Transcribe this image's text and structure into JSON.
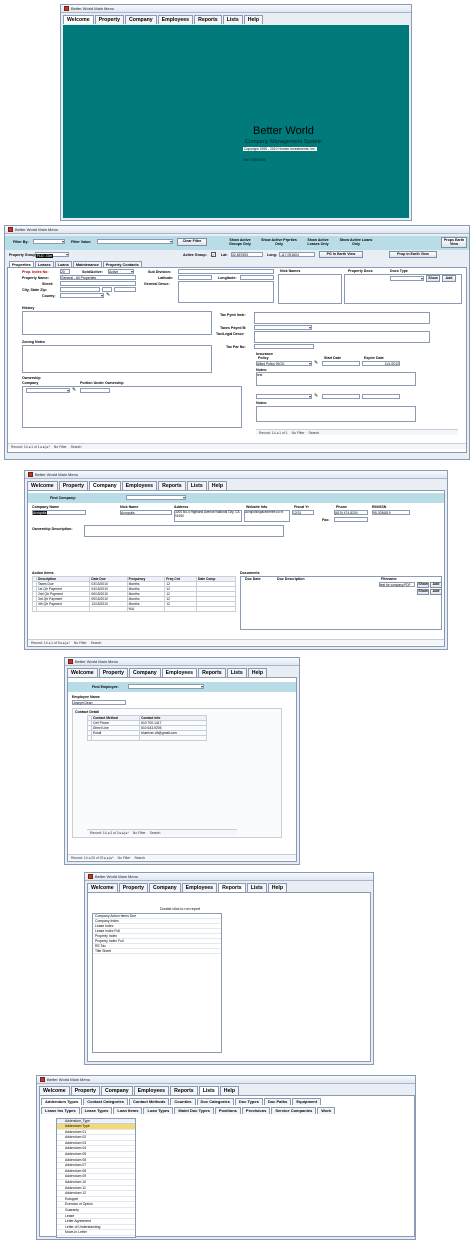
{
  "app_title": "Better World Main Menu",
  "main_tabs": [
    "Welcome",
    "Property",
    "Company",
    "Employees",
    "Reports",
    "Lists",
    "Help"
  ],
  "welcome": {
    "title": "Better World",
    "subtitle": "Company Management System",
    "copyright": "Copyright 1995 - 2010 Homec Investments, Inc.",
    "version": "Ver 2/19/2009",
    "bg_color": "#007a7a"
  },
  "property": {
    "filter_by_label": "Filter By:",
    "filter_value_label": "Filter Value:",
    "clear_filter": "Clear Filter",
    "show_active_groups": "Show Active Groups Only",
    "show_active_properties": "Show Active Prprties Only",
    "show_active_leases": "Show Active Leases Only",
    "show_active_loans": "Show Active Loans Only",
    "props_earth_view": "Props Earth View",
    "property_group_label": "Property Group:",
    "property_group_value": "FLD - Gnr",
    "active_group_label": "Active Group:",
    "lat_label": "Lat:",
    "lat_value": "32.657693",
    "long_label": "Long:",
    "long_value": "-117.091604",
    "pg_earth_view": "PG In Earth View",
    "prop_earth_view": "Prop In Earth View",
    "sub_tabs": [
      "Properties",
      "Leases",
      "Loans",
      "Maintenance",
      "Property Contacts"
    ],
    "prop_index_label": "Prop. Index No:",
    "prop_index_value": "20",
    "sold_active_label": "Sold/Active:",
    "sold_active_value": "Active",
    "property_name_label": "Property Name:",
    "property_name_value": "General - All Properties",
    "street_label": "Street:",
    "city_state_zip_label": "City, State Zip:",
    "county_label": "County:",
    "sub_division_label": "Sub Division:",
    "latitude_label": "Latitude:",
    "longitude_label": "Longitude:",
    "general_descr_label": "General Descr:",
    "nick_names_label": "Nick Names",
    "property_docs_label": "Property Docs",
    "docs_type_label": "Docs Type",
    "show": "Show",
    "add": "Add",
    "history_label": "History",
    "tax_pymt_instr_label": "Tax Pymt Instr:",
    "taxes_payed_label": "Taxes Payed B:",
    "tax_legal_descr_label": "Tax/Legal Descr:",
    "tax_par_no_label": "Tax Par No:",
    "zoning_notes_label": "Zoning Notes",
    "insurance_label": "Insurance",
    "policy_label": "Policy",
    "start_date_label": "Start Date",
    "expire_date_label": "Expire Date",
    "policy_value": "Allied Policy 09/10-",
    "expire_value": "11/1/2010",
    "notes_label": "Notes:",
    "notes_value": "test",
    "notes2_label": "Notes:",
    "ownership_label": "Ownership",
    "company_label": "Company",
    "portion_label": "Portion Under Ownership",
    "record_nav": "Record: 14 ◂ 1 of 1 ▸ ▸| ▸*",
    "inner_record_nav": "Record: 14 ◂ 1 of 1",
    "no_filter": "No Filter",
    "search": "Search"
  },
  "company": {
    "find_company_label": "Find Company:",
    "headers": [
      "Company Name",
      "Nick Name",
      "Address",
      "Website Info",
      "Fiscal Yr",
      "Phone",
      "EIN/SSN"
    ],
    "company_name": "Acropolis",
    "nick_name": "Acropolis",
    "address": "3200 B4-4 Highland Avenue National City, CA 91950",
    "website": "Acropolicspacecentre.co m",
    "fiscal_yr": "12/31",
    "phone": "(619) 474-8200",
    "fax_label": "Fax:",
    "ein": "95-3036819",
    "ownership_desc_label": "Ownership Description:",
    "action_items_label": "Action Items",
    "action_headers": [
      "Description",
      "Date Due",
      "Frequency",
      "Freq Cnt",
      "Date Comp"
    ],
    "actions": [
      [
        "Taxes Due",
        "03/15/2010",
        "Months",
        "12",
        ""
      ],
      [
        "1st Qtr Payment",
        "04/15/2010",
        "Months",
        "12",
        ""
      ],
      [
        "2nd Qtr Payment",
        "06/15/2010",
        "Months",
        "12",
        ""
      ],
      [
        "3rd Qtr Payment",
        "09/15/2010",
        "Months",
        "12",
        ""
      ],
      [
        "4th Qtr Payment",
        "12/15/2010",
        "Months",
        "12",
        ""
      ],
      [
        "",
        "",
        "N/A",
        "",
        ""
      ]
    ],
    "documents_label": "Documents",
    "doc_headers": [
      "Doc Date",
      "Doc Description",
      "Filename"
    ],
    "doc_filename": "test for company.PDF",
    "show": "Show",
    "add": "Add",
    "record_nav": "Record: 14 ◂ 1 of 5 ▸ ▸| ▸*",
    "no_filter": "No Filter",
    "search": "Search"
  },
  "employees": {
    "find_employee_label": "Find Employee:",
    "employee_name_label": "Employee Name",
    "employee_name": "Joseph Dean",
    "contact_detail_label": "Contact Detail",
    "contact_method_label": "Contact Method",
    "contact_info_label": "Contact Info",
    "contacts": [
      [
        "Cell Phone",
        "610 700-1417"
      ],
      [
        "Direct Line",
        "610 643-9205"
      ],
      [
        "Email",
        "blueriver-dh@gmail.com"
      ],
      [
        "",
        ""
      ]
    ],
    "inner_record_nav": "Record: 14 ◂ 3 of 3 ▸ ▸| ▸*",
    "record_nav": "Record: 14 ◂ 20 of 20 ▸ ▸| ▸*",
    "no_filter": "No Filter",
    "search": "Search"
  },
  "reports": {
    "hint": "Double click to run report",
    "items": [
      "Company Action Items Due",
      "Company Index",
      "Lease Index",
      "Lease Index Full",
      "Property Index",
      "Property Index Full",
      "RE Tax",
      "Title Sheet"
    ]
  },
  "lists": {
    "tabs_row1": [
      "Addendum Types",
      "Contact Categories",
      "Contact Methods",
      "Counties",
      "Doc Categories",
      "Doc Types",
      "Doc Paths",
      "Equipment"
    ],
    "tabs_row2": [
      "Lease Ins Types",
      "Lease Types",
      "Loan Items",
      "Loan Types",
      "Maint Doc Types",
      "Positions",
      "Provisions",
      "Service Companies",
      "Work"
    ],
    "column_header": "Addendum_Type",
    "items": [
      "Addendum Type",
      "Addendum 01",
      "Addendum 02",
      "Addendum 03",
      "Addendum 04",
      "Addendum 05",
      "Addendum 06",
      "Addendum 07",
      "Addendum 08",
      "Addendum 09",
      "Addendum 10",
      "Addendum 11",
      "Addendum 12",
      "Estoppel",
      "Exercise of Option",
      "Guaranty",
      "Lease",
      "Letter Agreement",
      "Letter of Understanding",
      "Move-In Letter"
    ]
  }
}
